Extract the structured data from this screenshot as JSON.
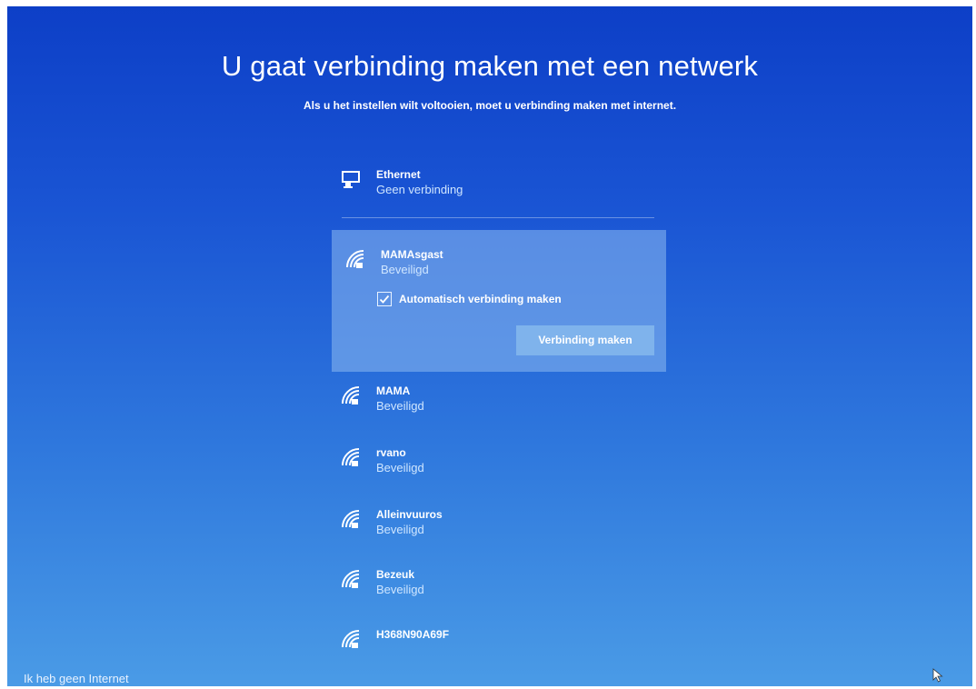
{
  "header": {
    "title": "U gaat verbinding maken met een netwerk",
    "subtitle": "Als u het instellen wilt voltooien, moet u verbinding maken met internet."
  },
  "ethernet": {
    "name": "Ethernet",
    "status": "Geen verbinding",
    "icon": "ethernet-icon"
  },
  "selected_network": {
    "name": "MAMAsgast",
    "status": "Beveiligd",
    "icon": "wifi-secure-icon",
    "auto_connect_label": "Automatisch verbinding maken",
    "auto_connect_checked": true,
    "connect_button": "Verbinding maken"
  },
  "networks": [
    {
      "name": "MAMA",
      "status": "Beveiligd",
      "icon": "wifi-secure-icon"
    },
    {
      "name": "rvano",
      "status": "Beveiligd",
      "icon": "wifi-secure-icon"
    },
    {
      "name": "Alleinvuuros",
      "status": "Beveiligd",
      "icon": "wifi-secure-icon"
    },
    {
      "name": "Bezeuk",
      "status": "Beveiligd",
      "icon": "wifi-secure-icon"
    },
    {
      "name": "H368N90A69F",
      "status": "",
      "icon": "wifi-secure-icon"
    }
  ],
  "footer": {
    "no_internet": "Ik heb geen Internet"
  },
  "colors": {
    "background_top": "#0d3fc7",
    "background_bottom": "#4a9be6",
    "panel": "#8cb9f0",
    "button": "#7fb3ec",
    "status_text": "#cfe6ff"
  }
}
